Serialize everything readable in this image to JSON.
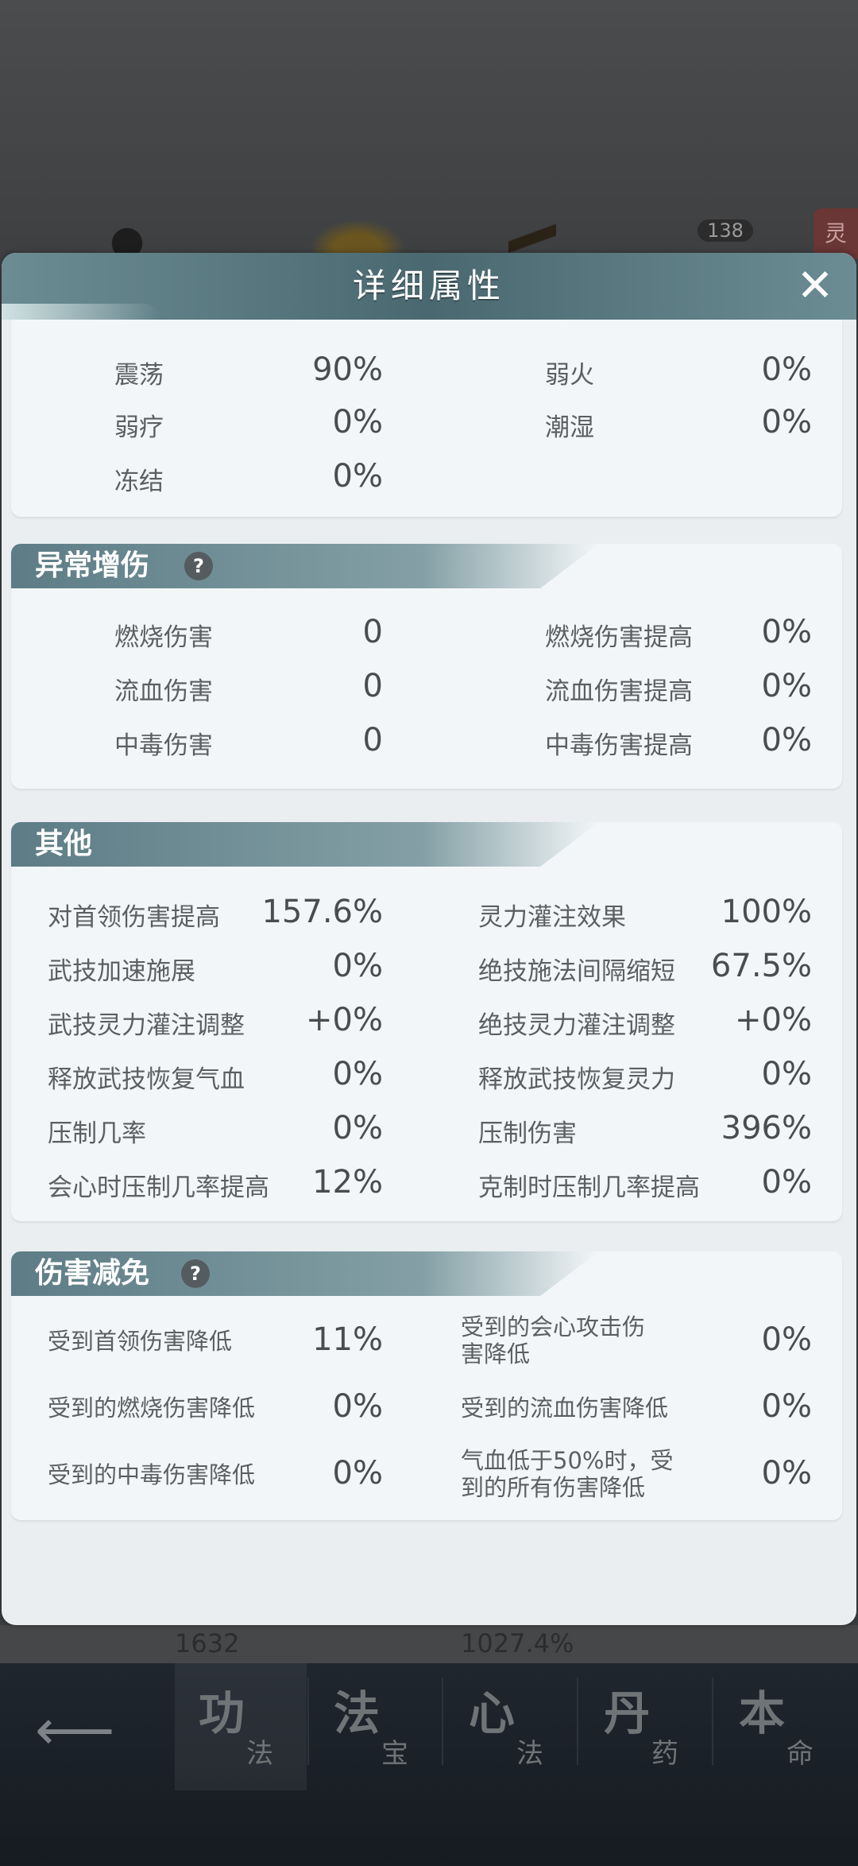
{
  "background": {
    "level_badge": "138",
    "side_tag": "灵",
    "behind_left": "1632",
    "behind_right": "1027.4%"
  },
  "modal": {
    "title": "详细属性",
    "close_icon": "close-icon"
  },
  "sections": {
    "top_partial": {
      "rows": [
        {
          "l_label": "震荡",
          "l_value": "90%",
          "r_label": "弱火",
          "r_value": "0%"
        },
        {
          "l_label": "弱疗",
          "l_value": "0%",
          "r_label": "潮湿",
          "r_value": "0%"
        },
        {
          "l_label": "冻结",
          "l_value": "0%"
        }
      ]
    },
    "abnormal": {
      "title": "异常增伤",
      "help_icon": "question-icon",
      "rows": [
        {
          "l_label": "燃烧伤害",
          "l_value": "0",
          "r_label": "燃烧伤害提高",
          "r_value": "0%"
        },
        {
          "l_label": "流血伤害",
          "l_value": "0",
          "r_label": "流血伤害提高",
          "r_value": "0%"
        },
        {
          "l_label": "中毒伤害",
          "l_value": "0",
          "r_label": "中毒伤害提高",
          "r_value": "0%"
        }
      ]
    },
    "other": {
      "title": "其他",
      "rows": [
        {
          "l_label": "对首领伤害提高",
          "l_value": "157.6%",
          "r_label": "灵力灌注效果",
          "r_value": "100%"
        },
        {
          "l_label": "武技加速施展",
          "l_value": "0%",
          "r_label": "绝技施法间隔缩短",
          "r_value": "67.5%"
        },
        {
          "l_label": "武技灵力灌注调整",
          "l_value": "+0%",
          "r_label": "绝技灵力灌注调整",
          "r_value": "+0%"
        },
        {
          "l_label": "释放武技恢复气血",
          "l_value": "0%",
          "r_label": "释放武技恢复灵力",
          "r_value": "0%"
        },
        {
          "l_label": "压制几率",
          "l_value": "0%",
          "r_label": "压制伤害",
          "r_value": "396%"
        },
        {
          "l_label": "会心时压制几率提高",
          "l_value": "12%",
          "r_label": "克制时压制几率提高",
          "r_value": "0%"
        }
      ]
    },
    "reduction": {
      "title": "伤害减免",
      "help_icon": "question-icon",
      "rows": [
        {
          "l_label": "受到首领伤害降低",
          "l_value": "11%",
          "r_label_1": "受到的会心攻击伤",
          "r_label_2": "害降低",
          "r_value": "0%"
        },
        {
          "l_label": "受到的燃烧伤害降低",
          "l_value": "0%",
          "r_label_1": "受到的流血伤害降低",
          "r_label_2": "",
          "r_value": "0%"
        },
        {
          "l_label": "受到的中毒伤害降低",
          "l_value": "0%",
          "r_label_1": "气血低于50%时，受",
          "r_label_2": "到的所有伤害降低",
          "r_value": "0%"
        }
      ]
    }
  },
  "bottom_nav": {
    "back_icon": "back-arrow-icon",
    "tabs": [
      {
        "big": "功",
        "small": "法"
      },
      {
        "big": "法",
        "small": "宝"
      },
      {
        "big": "心",
        "small": "法"
      },
      {
        "big": "丹",
        "small": "药"
      },
      {
        "big": "本",
        "small": "命"
      }
    ]
  }
}
